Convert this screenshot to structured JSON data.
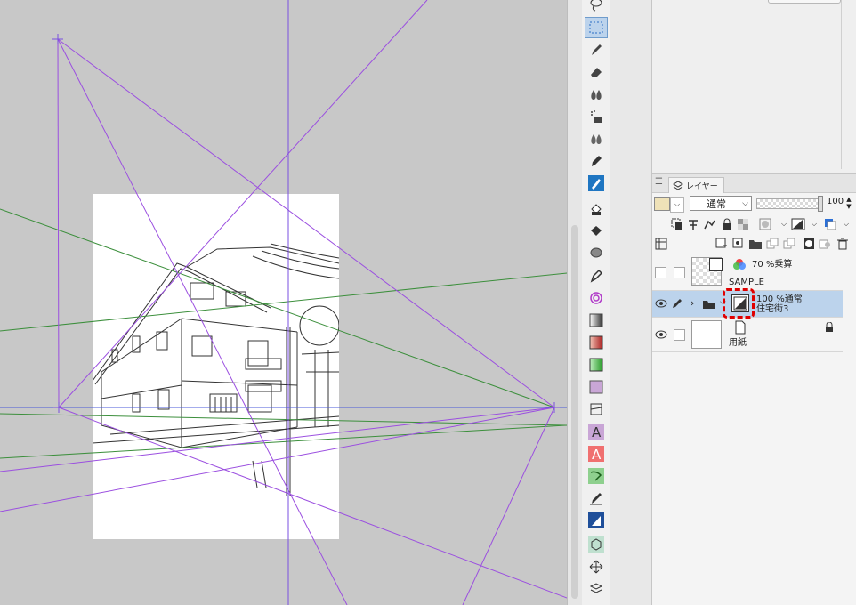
{
  "layer_panel": {
    "tab_label": "レイヤー",
    "blend_mode": "通常",
    "opacity_value": "100",
    "layers": [
      {
        "blend": "70 %乗算",
        "name": "SAMPLE"
      },
      {
        "blend": "100 %通常",
        "name": "住宅街3"
      },
      {
        "blend": "",
        "name": "用紙"
      }
    ]
  },
  "colors": {
    "canvas_bg": "#c8c8c8",
    "selected_layer": "#bcd3ec",
    "highlight": "#e00000",
    "perspective_purple": "#9b4fe0",
    "perspective_green": "#3c8f3c",
    "horizon_blue": "#4a5ad8"
  }
}
